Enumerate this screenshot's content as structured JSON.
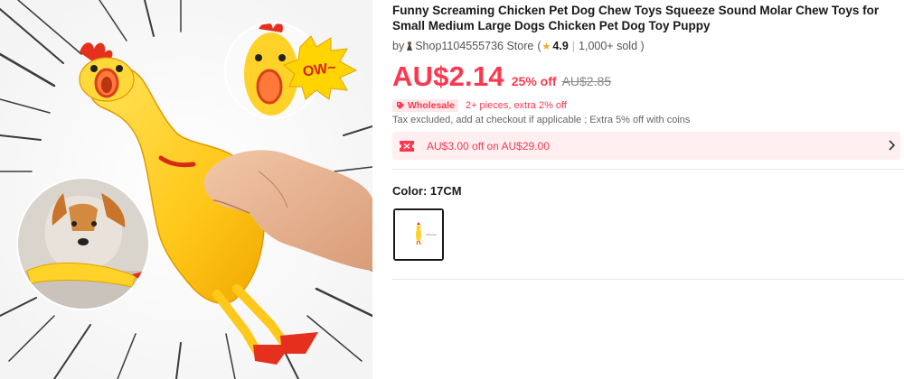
{
  "product": {
    "title": "Funny Screaming Chicken Pet Dog Chew Toys Squeeze Sound Molar Chew Toys for Small Medium Large Dogs Chicken Pet Dog Toy Puppy",
    "image_caption": "OW~"
  },
  "store": {
    "by_label": "by",
    "name": "Shop1104555736 Store",
    "open_paren": "(",
    "rating": "4.9",
    "separator": "|",
    "sold": "1,000+ sold )"
  },
  "price": {
    "current": "AU$2.14",
    "discount": "25% off",
    "original": "AU$2.85"
  },
  "wholesale": {
    "badge": "Wholesale",
    "text": "2+ pieces, extra 2% off"
  },
  "tax_note": "Tax excluded, add at checkout if applicable ; Extra 5% off with coins",
  "coupon": {
    "text": "AU$3.00 off on AU$29.00"
  },
  "variant": {
    "label": "Color: 17CM",
    "swatch_caption": "17cm Le"
  },
  "colors": {
    "accent": "#fd384f",
    "coupon_bg": "#ffeff1",
    "star": "#f5a623"
  },
  "icons": [
    "store-avatar-icon",
    "star-icon",
    "tag-icon",
    "coupon-ticket-icon",
    "chevron-right-icon"
  ]
}
